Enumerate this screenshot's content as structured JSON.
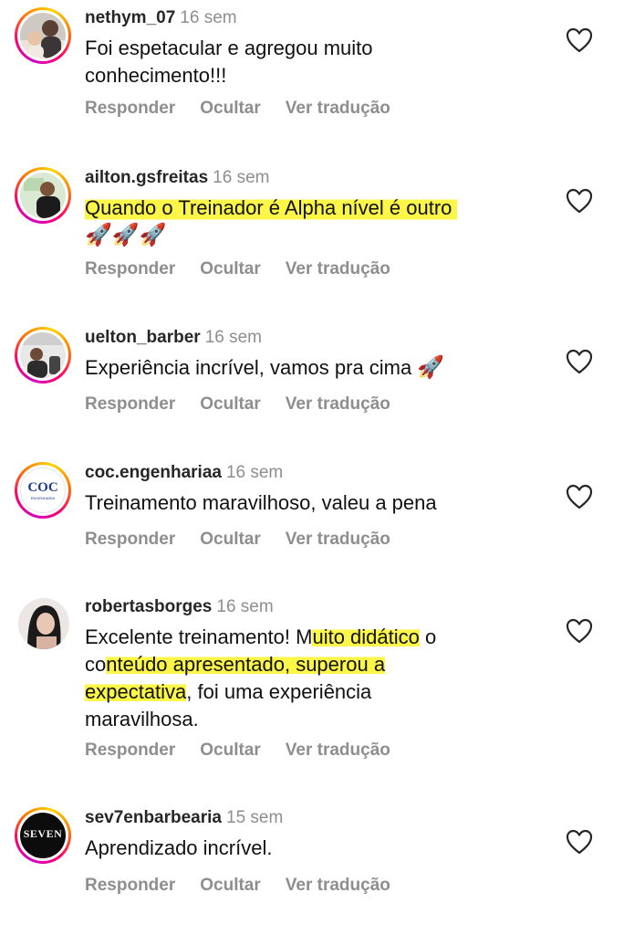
{
  "comments": [
    {
      "username": "nethym_07",
      "time": "16 sem",
      "lines": [
        "Foi espetacular e agregou muito",
        "conhecimento!!!"
      ],
      "actions": {
        "reply": "Responder",
        "hide": "Ocultar",
        "translate": "Ver tradução"
      }
    },
    {
      "username": "ailton.gsfreitas",
      "time": "16 sem",
      "lines": [
        "Quando o Treinador é Alpha nível é outro"
      ],
      "emoji_line": "🚀🚀🚀",
      "actions": {
        "reply": "Responder",
        "hide": "Ocultar",
        "translate": "Ver tradução"
      }
    },
    {
      "username": "uelton_barber",
      "time": "16 sem",
      "lines": [
        "Experiência incrível, vamos pra cima"
      ],
      "emoji": "🚀",
      "actions": {
        "reply": "Responder",
        "hide": "Ocultar",
        "translate": "Ver tradução"
      }
    },
    {
      "username": "coc.engenhariaa",
      "time": "16 sem",
      "lines": [
        "Treinamento maravilhoso, valeu a pena"
      ],
      "avatar_logo": "COC",
      "avatar_logo_sub": "ENGENHARIA",
      "actions": {
        "reply": "Responder",
        "hide": "Ocultar",
        "translate": "Ver tradução"
      }
    },
    {
      "username": "robertasborges",
      "time": "16 sem",
      "line1_a": "Excelente treinamento! M",
      "line1_b": "uito didático",
      "line1_c": " o",
      "line2_a": "co",
      "line2_b": "nteúdo apresentado, superou a",
      "line3_a": "expectativa",
      "line3_b": ", foi uma experiência",
      "line4": "maravilhosa.",
      "actions": {
        "reply": "Responder",
        "hide": "Ocultar",
        "translate": "Ver tradução"
      }
    },
    {
      "username": "sev7enbarbearia",
      "time": "15 sem",
      "lines": [
        "Aprendizado incrível."
      ],
      "avatar_logo": "SEVEN",
      "actions": {
        "reply": "Responder",
        "hide": "Ocultar",
        "translate": "Ver tradução"
      }
    }
  ],
  "icons": {
    "like": "heart-outline-icon"
  },
  "colors": {
    "muted": "#8e8e8e",
    "highlight": "#faf528",
    "text": "#111111"
  }
}
